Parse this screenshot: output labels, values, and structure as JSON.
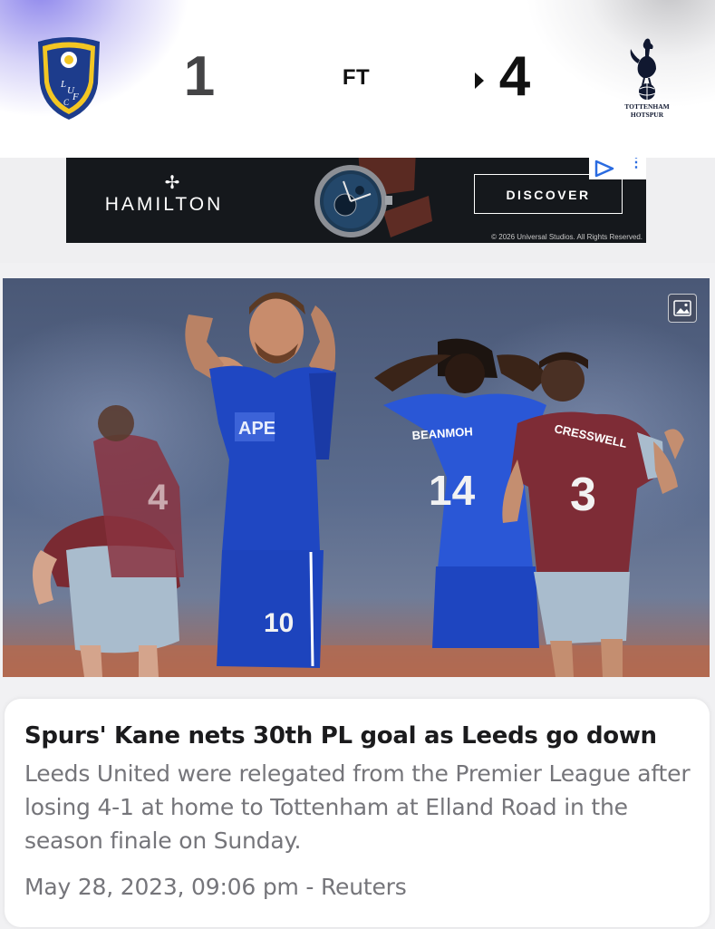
{
  "match": {
    "home": {
      "crest_icon": "leeds-united-crest-icon",
      "crest_text": "LUFC",
      "score": "1"
    },
    "away": {
      "crest_icon": "tottenham-hotspur-crest-icon",
      "crest_text": "TOTTENHAM HOTSPUR",
      "score": "4"
    },
    "status": "FT",
    "winner_marker_icon": "triangle-right-icon"
  },
  "ad": {
    "brand_mark": "✢",
    "brand": "HAMILTON",
    "cta": "DISCOVER",
    "legal": "© 2026 Universal Studios. All Rights Reserved.",
    "adchoices_icon": "adchoices-play-icon",
    "menu_icon": "more-vertical-icon",
    "product_icon": "wristwatch-icon"
  },
  "photo": {
    "badge_icon": "image-icon",
    "jersey_numbers": [
      "10",
      "14",
      "3"
    ],
    "jersey_names": [
      "BEANMOH",
      "CRESSWELL"
    ]
  },
  "article": {
    "headline": "Spurs' Kane nets 30th PL goal as Leeds go down",
    "summary": "Leeds United were relegated from the Premier League after losing 4-1 at home to Tottenham at Elland Road in the season finale on Sunday.",
    "meta": "May 28, 2023, 09:06 pm - Reuters"
  },
  "colors": {
    "header_glow_left": "#6d60e6",
    "score_home": "#444446",
    "score_away": "#111111",
    "ad_background": "#15181c",
    "headline": "#1b1b1d",
    "secondary_text": "#75757a"
  }
}
